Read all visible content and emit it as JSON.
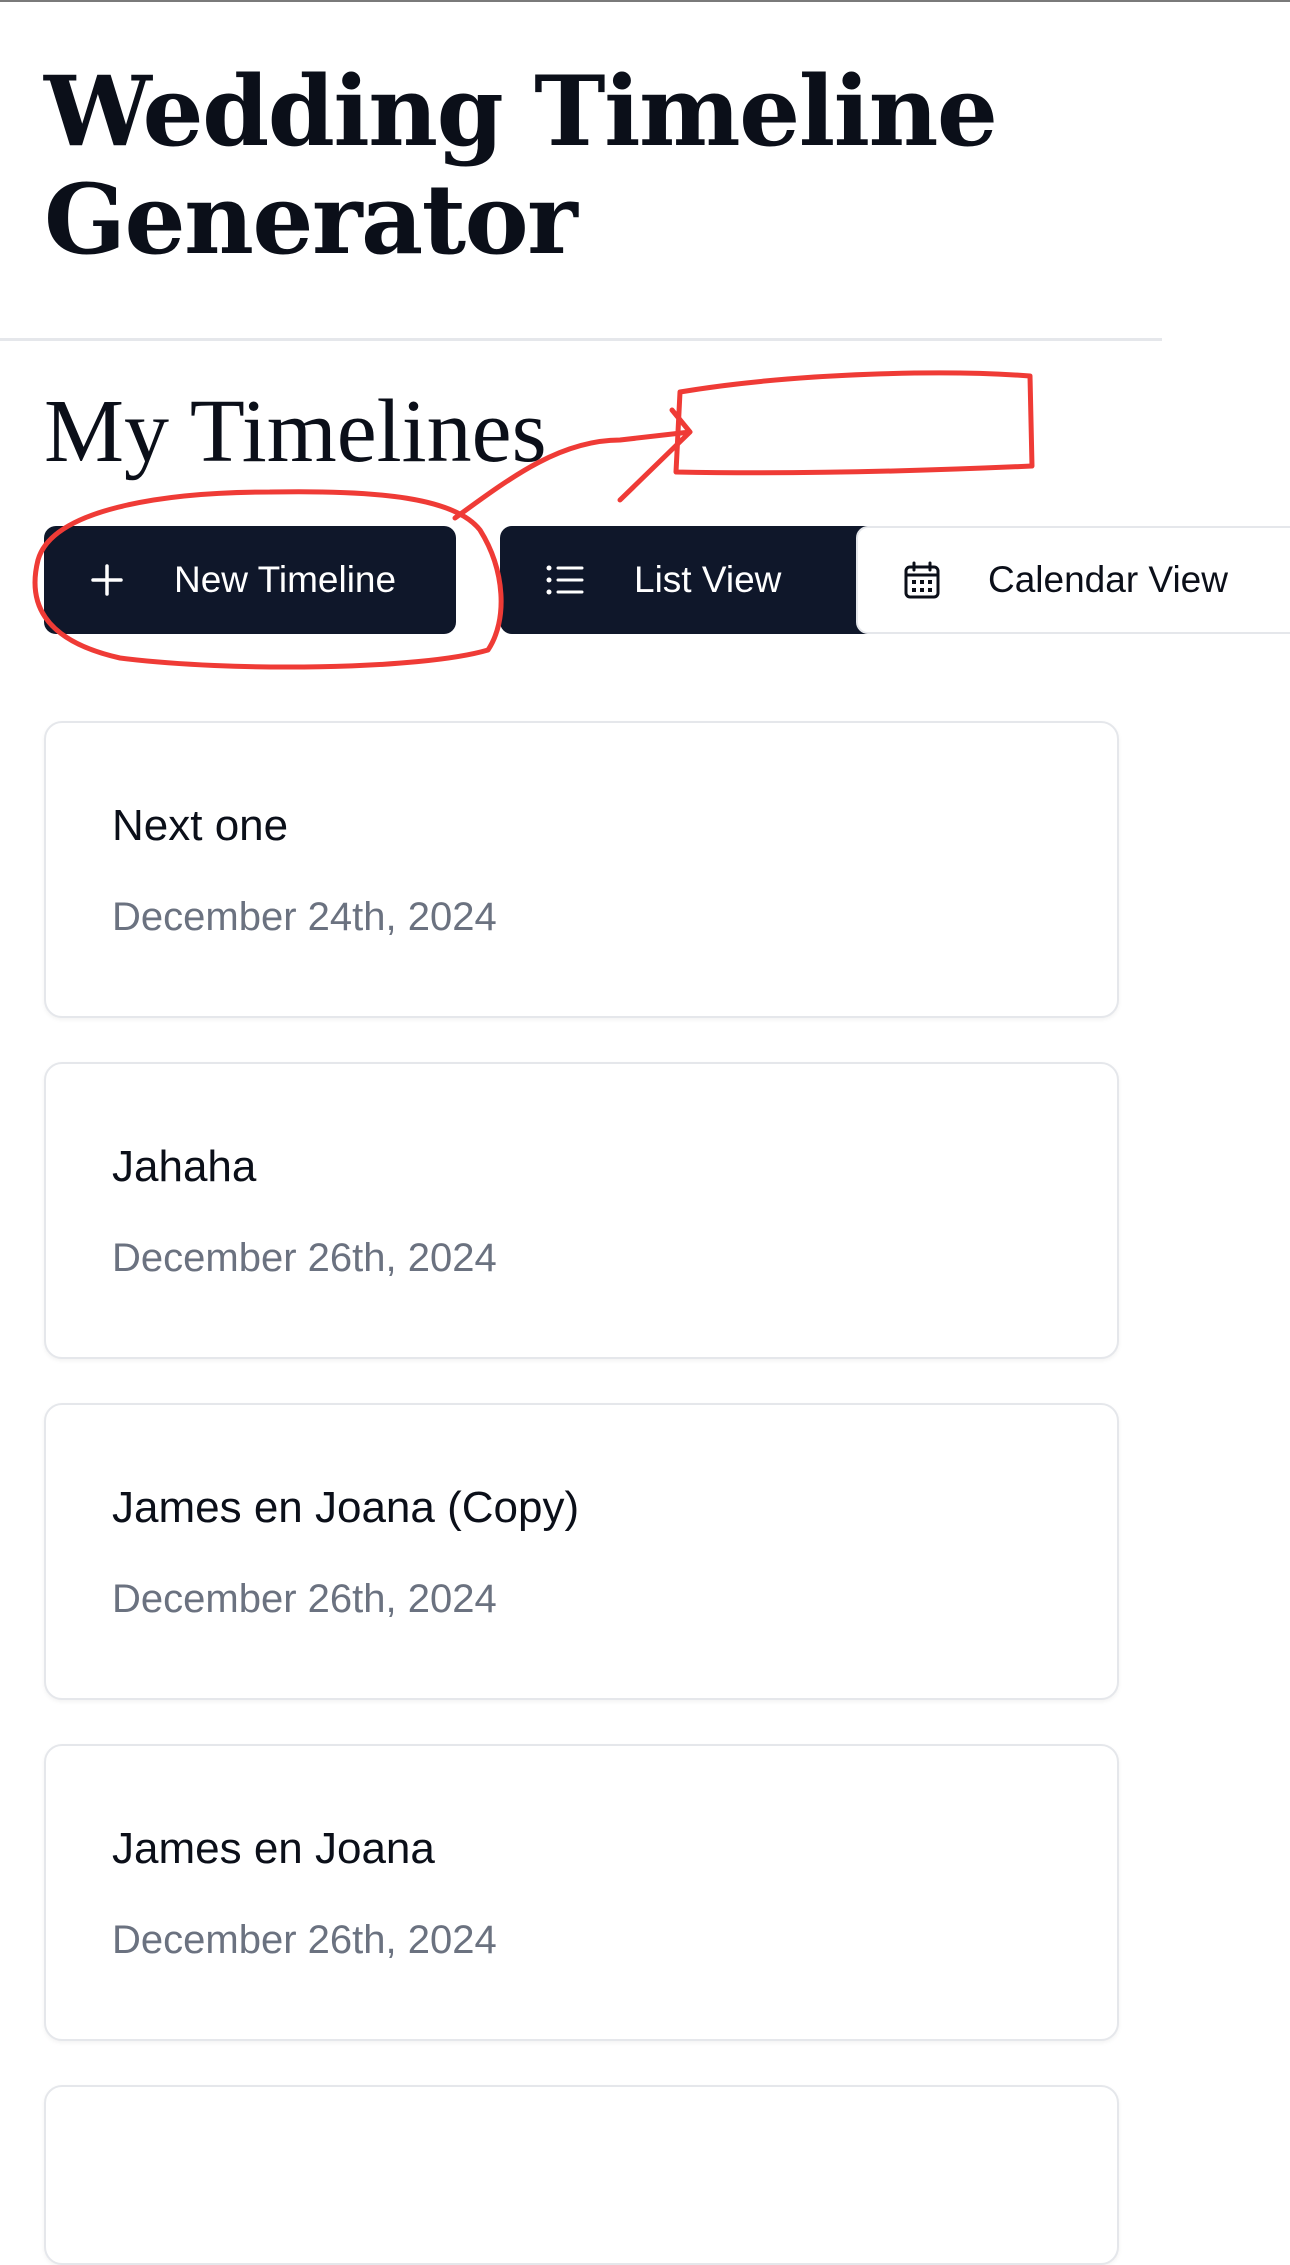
{
  "header": {
    "title": "Wedding Timeline Generator"
  },
  "section": {
    "title": "My Timelines"
  },
  "toolbar": {
    "new_label": "New Timeline",
    "list_label": "List View",
    "calendar_label": "Calendar View"
  },
  "timelines": [
    {
      "title": "Next one",
      "date": "December 24th, 2024"
    },
    {
      "title": "Jahaha",
      "date": "December 26th, 2024"
    },
    {
      "title": "James en Joana (Copy)",
      "date": "December 26th, 2024"
    },
    {
      "title": "James en Joana",
      "date": "December 26th, 2024"
    },
    {
      "title": "",
      "date": ""
    }
  ],
  "icons": {
    "new": "plus-icon",
    "list": "list-icon",
    "calendar": "calendar-icon"
  },
  "colors": {
    "primary": "#0f172a",
    "text": "#0b0f19",
    "muted": "#6b7280",
    "border": "#e5e7eb",
    "annotation": "#ef3b36"
  }
}
